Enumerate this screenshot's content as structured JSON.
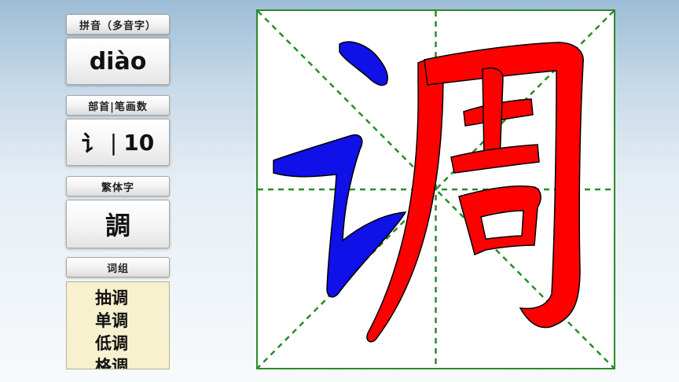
{
  "pinyin": {
    "label": "拼音（多音字）",
    "value": "diào"
  },
  "radical_strokes": {
    "label": "部首|笔画数",
    "radical": "讠",
    "separator": "|",
    "strokes": "10"
  },
  "traditional": {
    "label": "繁体字",
    "value": "調"
  },
  "words": {
    "label": "词组",
    "items": [
      "抽调",
      "单调",
      "低调",
      "格调"
    ]
  },
  "character": {
    "value": "调",
    "radical_color": "#1010e8",
    "body_color": "#ff0000",
    "outline_color": "#000000",
    "grid_color": "#2b8a2b"
  }
}
